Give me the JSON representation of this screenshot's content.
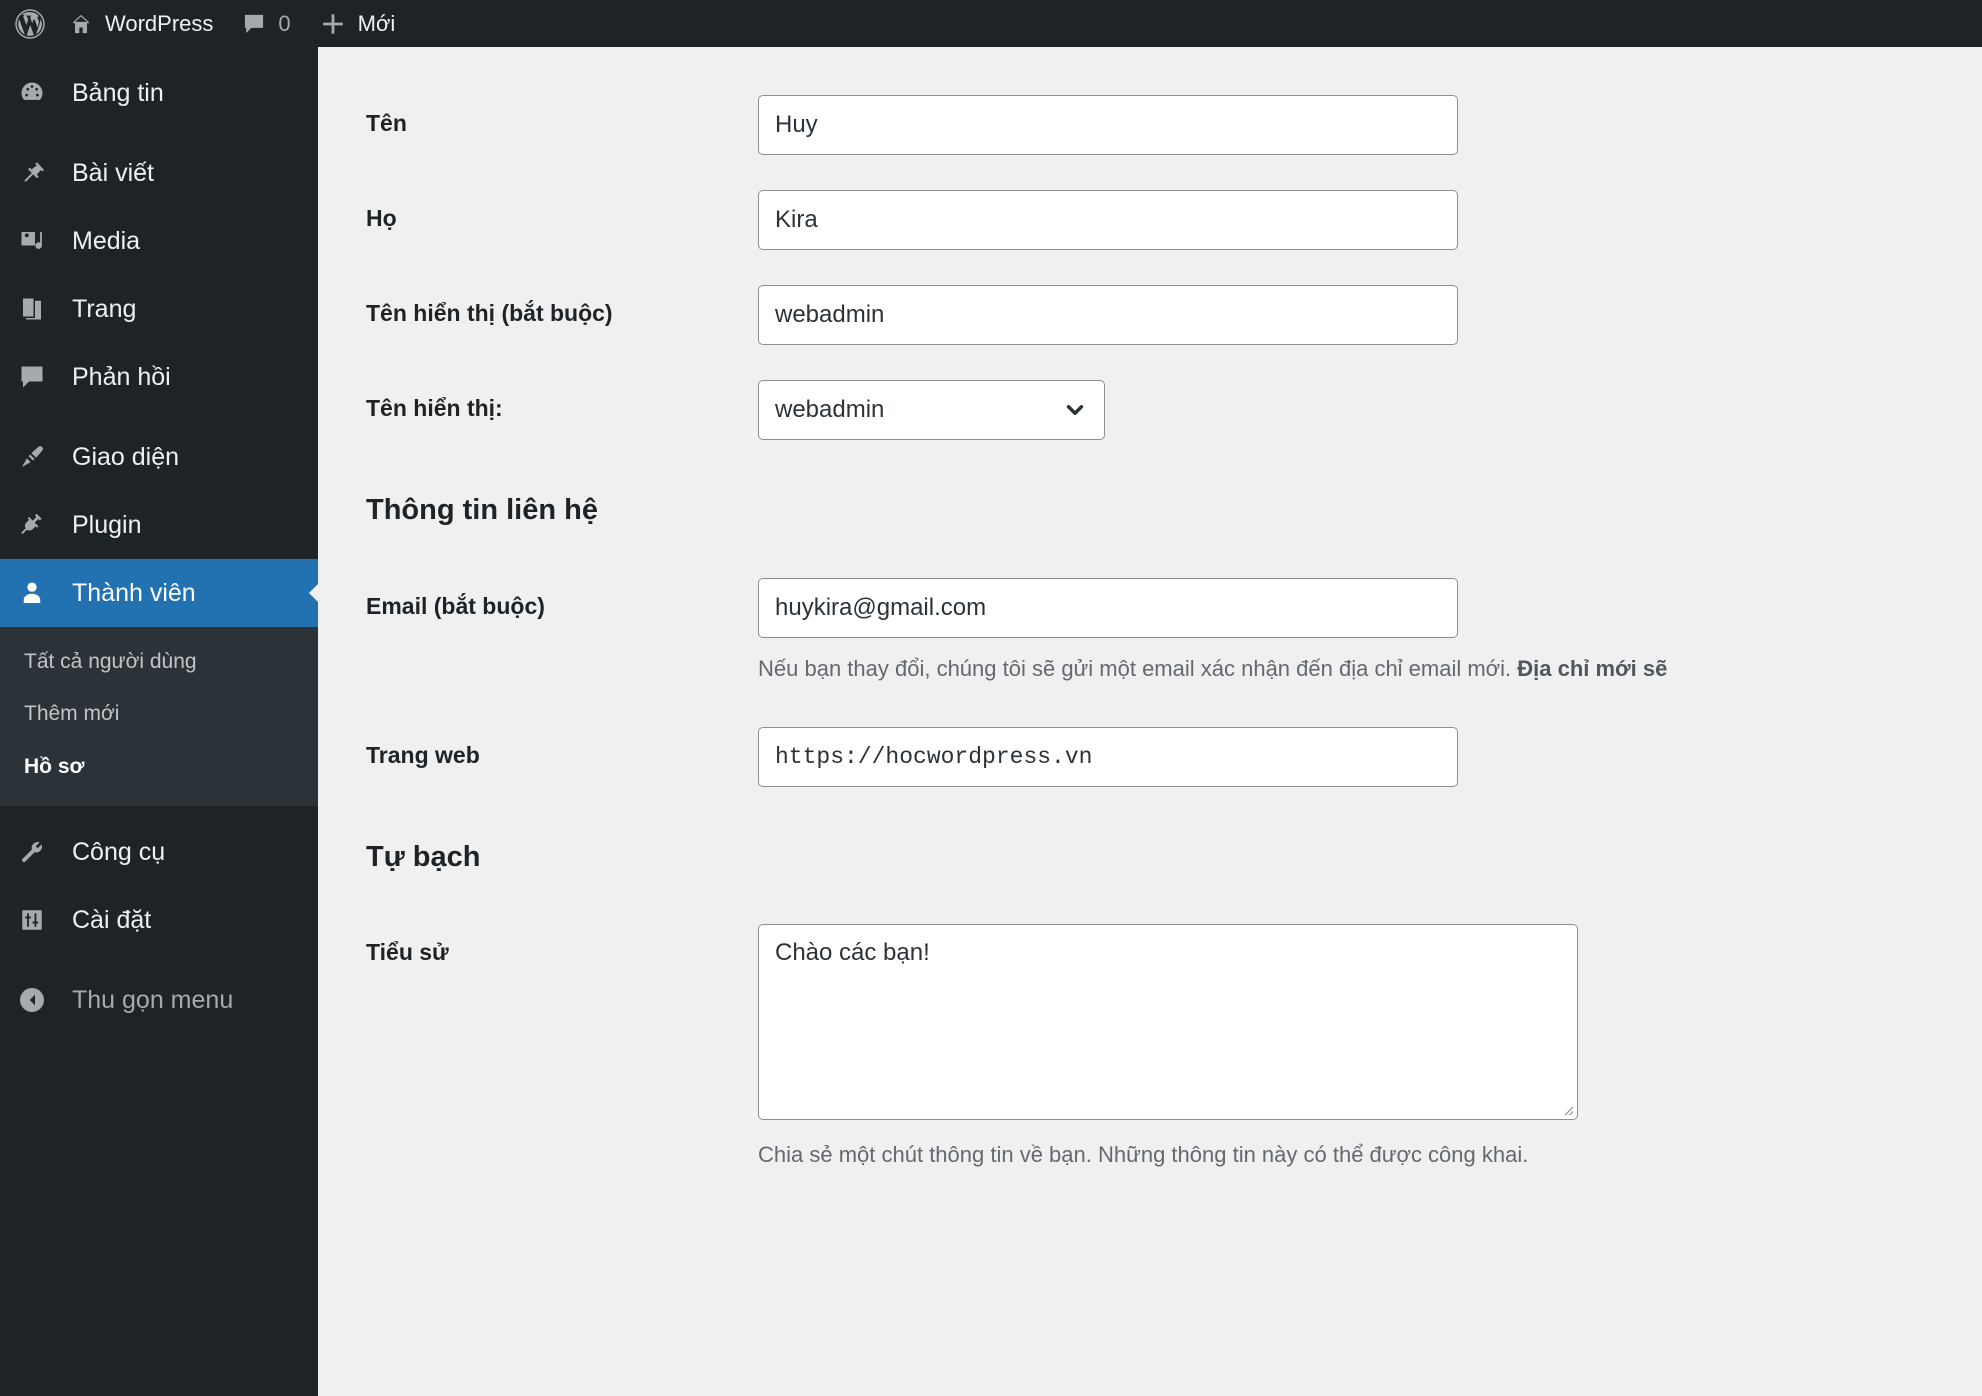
{
  "adminbar": {
    "logo_icon": "wordpress-logo-icon",
    "site_icon": "home-icon",
    "site_name": "WordPress",
    "comments_icon": "comment-bubble-icon",
    "comments_count": "0",
    "new_icon": "plus-icon",
    "new_label": "Mới"
  },
  "sidebar": {
    "items": [
      {
        "label": "Bảng tin",
        "icon": "dashboard-icon",
        "current": false
      },
      {
        "label": "Bài viết",
        "icon": "pin-icon",
        "current": false
      },
      {
        "label": "Media",
        "icon": "media-icon",
        "current": false
      },
      {
        "label": "Trang",
        "icon": "pages-icon",
        "current": false
      },
      {
        "label": "Phản hồi",
        "icon": "comment-bubble-icon",
        "current": false
      },
      {
        "label": "Giao diện",
        "icon": "paintbrush-icon",
        "current": false
      },
      {
        "label": "Plugin",
        "icon": "plug-icon",
        "current": false
      },
      {
        "label": "Thành viên",
        "icon": "user-icon",
        "current": true
      },
      {
        "label": "Công cụ",
        "icon": "wrench-icon",
        "current": false
      },
      {
        "label": "Cài đặt",
        "icon": "settings-sliders-icon",
        "current": false
      }
    ],
    "submenu": [
      {
        "label": "Tất cả người dùng",
        "current": false
      },
      {
        "label": "Thêm mới",
        "current": false
      },
      {
        "label": "Hồ sơ",
        "current": true
      }
    ],
    "collapse": {
      "label": "Thu gọn menu",
      "icon": "collapse-arrow-icon"
    }
  },
  "form": {
    "first_name": {
      "label": "Tên",
      "value": "Huy"
    },
    "last_name": {
      "label": "Họ",
      "value": "Kira"
    },
    "nickname": {
      "label": "Tên hiển thị (bắt buộc)",
      "value": "webadmin"
    },
    "display_name": {
      "label": "Tên hiển thị:",
      "value": "webadmin",
      "chevron_icon": "chevron-down-icon"
    },
    "contact_heading": "Thông tin liên hệ",
    "email": {
      "label": "Email (bắt buộc)",
      "value": "huykira@gmail.com",
      "description_normal": "Nếu bạn thay đổi, chúng tôi sẽ gửi một email xác nhận đến địa chỉ email mới. ",
      "description_strong": "Địa chỉ mới sẽ"
    },
    "website": {
      "label": "Trang web",
      "value": "https://hocwordpress.vn"
    },
    "about_heading": "Tự bạch",
    "bio": {
      "label": "Tiểu sử",
      "value": "Chào các bạn!",
      "description": "Chia sẻ một chút thông tin về bạn. Những thông tin này có thể được công khai."
    }
  },
  "colors": {
    "admin_dark": "#1d2327",
    "submenu_dark": "#2c3338",
    "accent_blue": "#2271b1",
    "page_bg": "#f0f0f1",
    "border_gray": "#8c8f94"
  }
}
